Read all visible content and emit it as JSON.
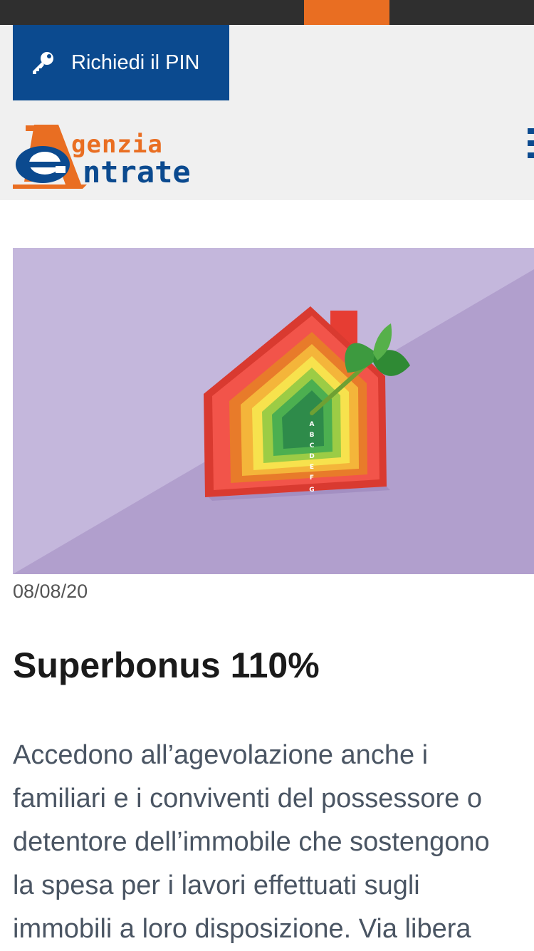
{
  "top_bar": {
    "accent_color": "#e96e22",
    "bg_color": "#2f2f2f"
  },
  "header": {
    "pin_button": {
      "label": "Richiedi il PIN",
      "icon": "key-icon"
    },
    "logo": {
      "line1": "genzia",
      "line2": "ntrate",
      "brand_orange": "#e96e22",
      "brand_blue": "#0b4a8f"
    },
    "menu": {
      "icon": "hamburger-menu-icon"
    }
  },
  "article": {
    "hero_image": {
      "description_icon": "energy-class-house-dart-image",
      "energy_classes": [
        "A",
        "B",
        "C",
        "D",
        "E",
        "F",
        "G"
      ]
    },
    "date": "08/08/20",
    "title": "Superbonus 110%",
    "body_lines": [
      "Accedono all’agevolazione anche i",
      "familiari e i conviventi del possessore o",
      "detentore dell’immobile che sostengono",
      "la spesa per i lavori effettuati sugli",
      "immobili a loro disposizione. Via libera"
    ]
  }
}
